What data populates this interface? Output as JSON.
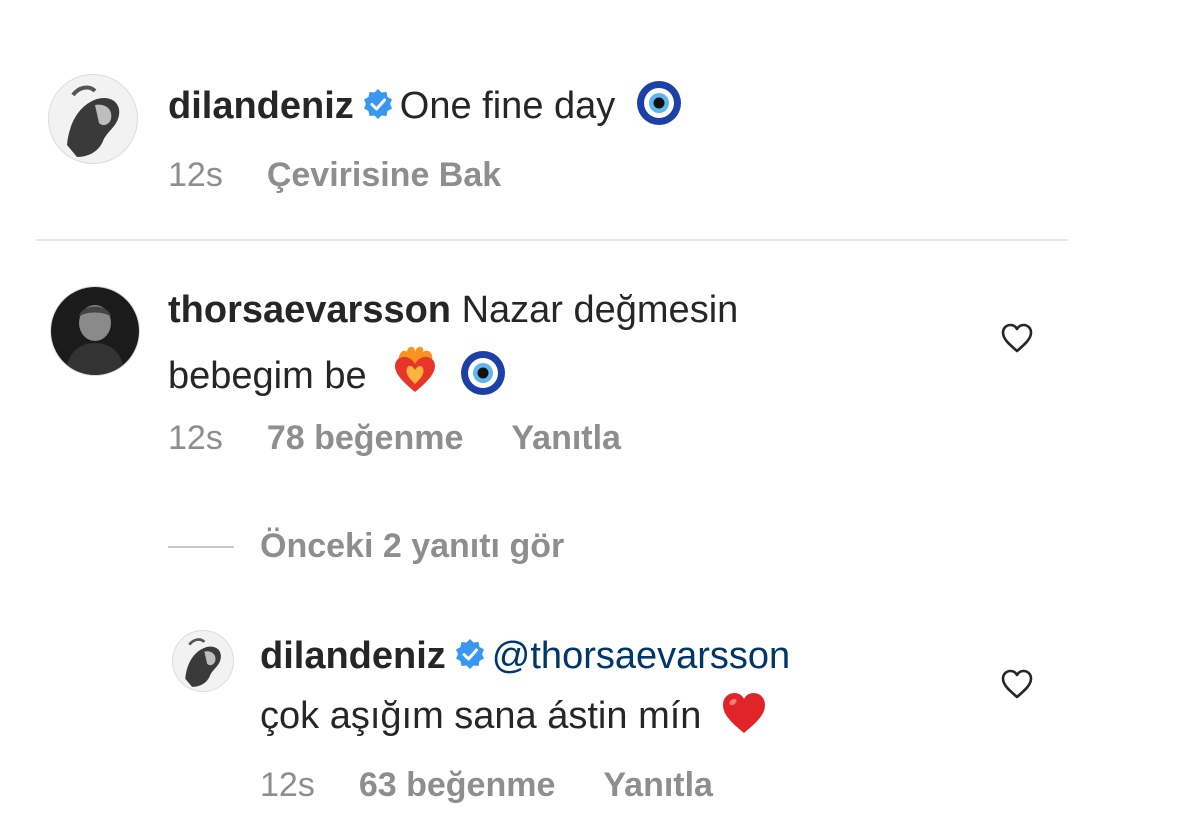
{
  "caption": {
    "username": "dilandeniz",
    "text": "One fine day",
    "emoji": "nazar-amulet",
    "time": "12s",
    "translate_label": "Çevirisine Bak"
  },
  "comment": {
    "username": "thorsaevarsson",
    "text_line1": "Nazar değmesin",
    "text_line2": "bebegim be",
    "emojis": [
      "heart-on-fire",
      "nazar-amulet"
    ],
    "time": "12s",
    "likes": "78 beğenme",
    "reply_label": "Yanıtla"
  },
  "view_replies": {
    "label": "Önceki 2 yanıtı gör"
  },
  "reply": {
    "username": "dilandeniz",
    "mention": "@thorsaevarsson",
    "text": "çok aşığım sana ástin mín",
    "emoji": "red-heart",
    "time": "12s",
    "likes": "63 beğenme",
    "reply_label": "Yanıtla"
  },
  "colors": {
    "text": "#262626",
    "meta": "#8e8e8e",
    "verified": "#3897f0",
    "mention": "#00376b",
    "divider": "#e6e6e6"
  }
}
